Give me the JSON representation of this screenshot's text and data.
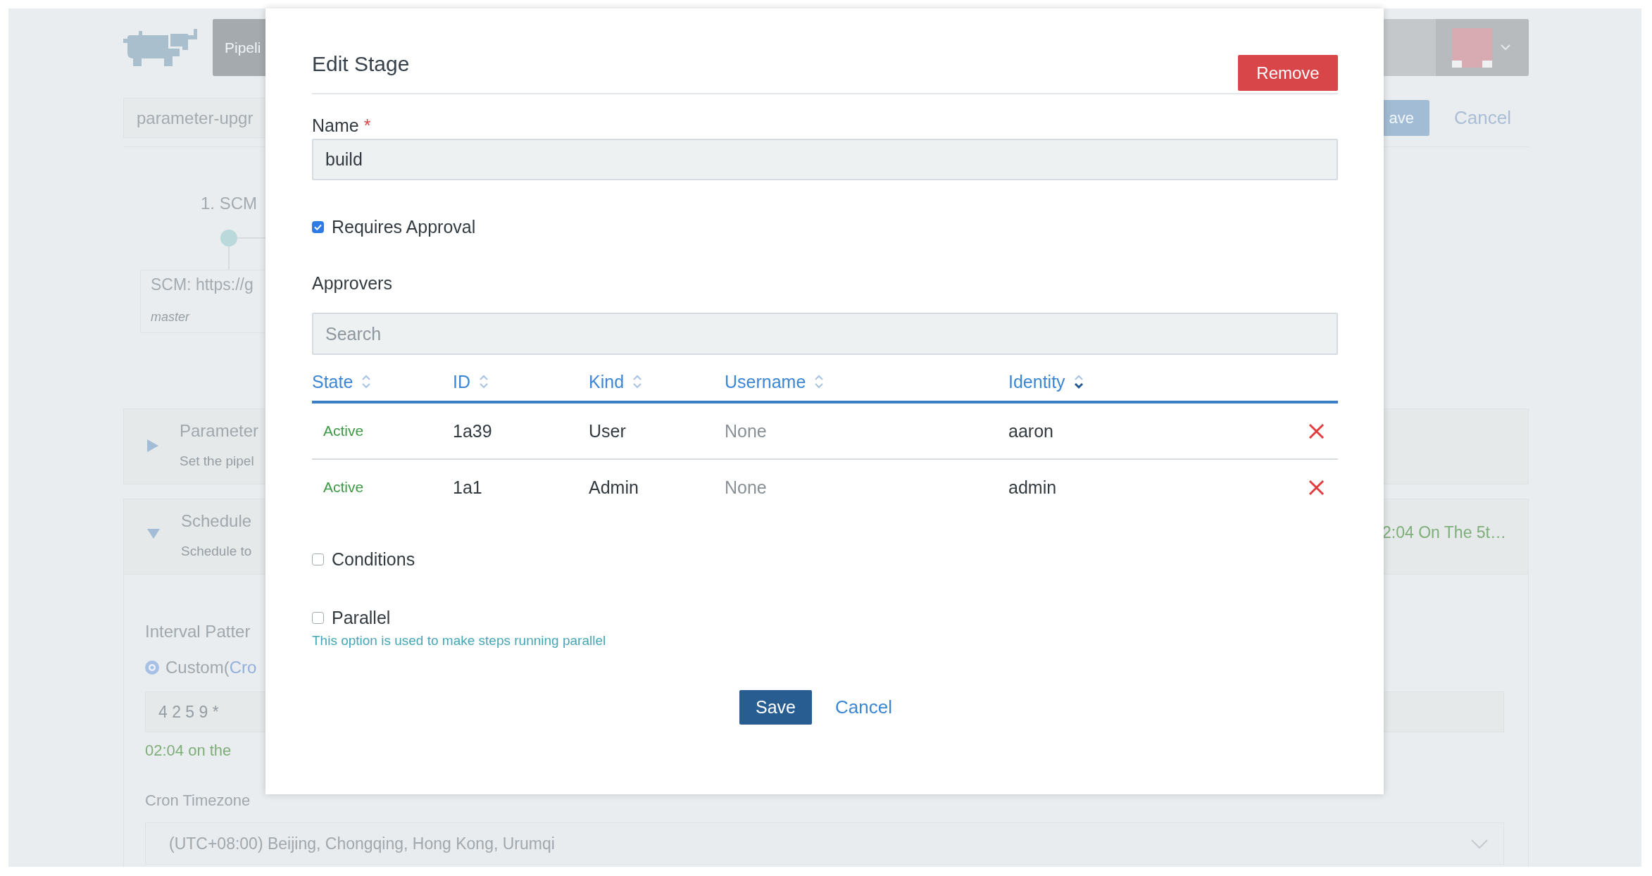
{
  "background": {
    "nav_item": "Pipeli",
    "pipeline_name": "parameter-upgr",
    "actions": {
      "save": "ave",
      "cancel": "Cancel"
    },
    "stage": {
      "title": "1. SCM",
      "source": "SCM: https://g",
      "branch": "master"
    },
    "sections": [
      {
        "title": "Parameter",
        "subtitle": "Set the pipel",
        "expanded": false
      },
      {
        "title": "Schedule",
        "subtitle": "Schedule to",
        "expanded": true,
        "summary": "2:04 On The 5t…",
        "body": {
          "interval_label": "Interval Patter",
          "option": {
            "label": "Custom(",
            "link": "Cro",
            "selected": true
          },
          "cron_value": "4 2 5 9 *",
          "description": "02:04 on the",
          "timezone_label": "Cron Timezone",
          "timezone_value": "(UTC+08:00) Beijing, Chongqing, Hong Kong, Urumqi"
        }
      }
    ]
  },
  "dialog": {
    "title": "Edit Stage",
    "remove_button": "Remove",
    "name": {
      "label": "Name",
      "required_mark": "*",
      "value": "build"
    },
    "requires_approval": {
      "label": "Requires Approval",
      "checked": true
    },
    "approvers": {
      "label": "Approvers",
      "search": {
        "placeholder": "Search"
      },
      "columns": [
        {
          "label": "State",
          "sorted": false
        },
        {
          "label": "ID",
          "sorted": false
        },
        {
          "label": "Kind",
          "sorted": false
        },
        {
          "label": "Username",
          "sorted": false
        },
        {
          "label": "Identity",
          "sorted": true
        }
      ],
      "rows": [
        {
          "state": "Active",
          "id": "1a39",
          "kind": "User",
          "username": "None",
          "identity": "aaron"
        },
        {
          "state": "Active",
          "id": "1a1",
          "kind": "Admin",
          "username": "None",
          "identity": "admin"
        }
      ]
    },
    "conditions": {
      "label": "Conditions",
      "checked": false
    },
    "parallel": {
      "label": "Parallel",
      "checked": false,
      "help": "This option is used to make steps running parallel"
    },
    "buttons": {
      "save": "Save",
      "cancel": "Cancel"
    }
  }
}
